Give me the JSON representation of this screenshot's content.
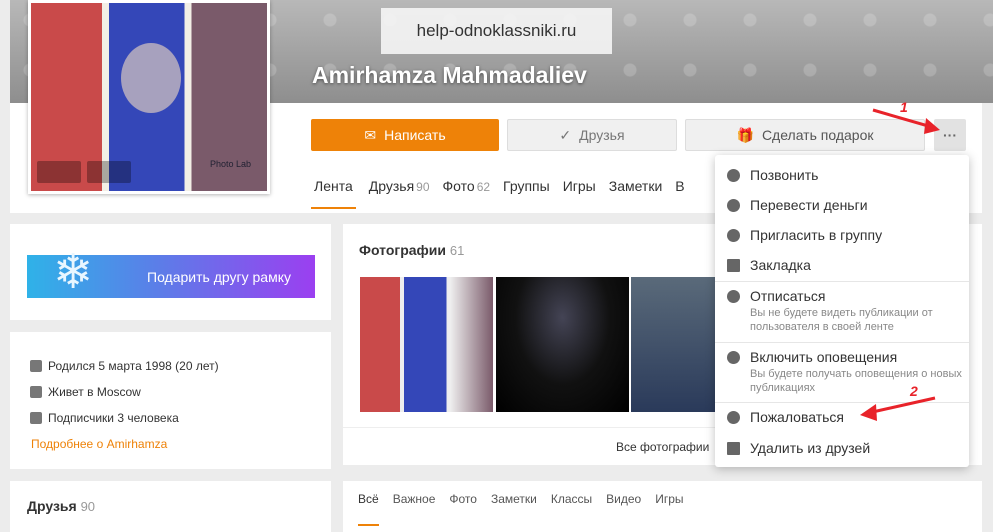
{
  "watermark": "help-odnoklassniki.ru",
  "profile": {
    "name": "Amirhamza Mahmadaliev",
    "avatar_caption": "Photo Lab"
  },
  "actions": {
    "write": "Написать",
    "friends": "Друзья",
    "gift": "Сделать подарок",
    "more": "···"
  },
  "tabs": [
    {
      "label": "Лента",
      "count": ""
    },
    {
      "label": "Друзья",
      "count": "90"
    },
    {
      "label": "Фото",
      "count": "62"
    },
    {
      "label": "Группы",
      "count": ""
    },
    {
      "label": "Игры",
      "count": ""
    },
    {
      "label": "Заметки",
      "count": ""
    },
    {
      "label": "В",
      "count": ""
    }
  ],
  "gift_frame": "Подарить другу рамку",
  "info": {
    "born": "Родился 5 марта 1998 (20 лет)",
    "lives": "Живет в Moscow",
    "subscribers": "Подписчики 3 человека",
    "more": "Подробнее о Amirhamza"
  },
  "photos_section": {
    "title": "Фотографии",
    "count": "61",
    "all": "Все фотографии"
  },
  "friends_section": {
    "title": "Друзья",
    "count": "90"
  },
  "feed_tabs": [
    "Всё",
    "Важное",
    "Фото",
    "Заметки",
    "Классы",
    "Видео",
    "Игры"
  ],
  "menu": [
    {
      "label": "Позвонить",
      "sub": ""
    },
    {
      "label": "Перевести деньги",
      "sub": ""
    },
    {
      "label": "Пригласить в группу",
      "sub": ""
    },
    {
      "label": "Закладка",
      "sub": ""
    },
    {
      "label": "Отписаться",
      "sub": "Вы не будете видеть публикации от пользователя в своей ленте"
    },
    {
      "label": "Включить оповещения",
      "sub": "Вы будете получать оповещения о новых публикациях"
    },
    {
      "label": "Пожаловаться",
      "sub": ""
    },
    {
      "label": "Удалить из друзей",
      "sub": ""
    }
  ],
  "annotations": [
    "1",
    "2"
  ],
  "colors": {
    "accent": "#ee8208",
    "annotation": "#e8232a"
  }
}
